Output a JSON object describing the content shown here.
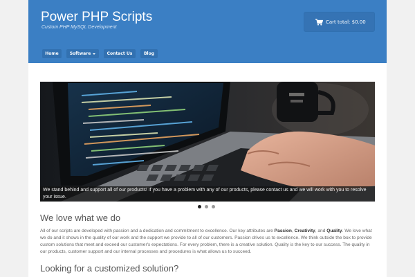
{
  "site": {
    "title": "Power PHP Scripts",
    "tagline": "Custom PHP MySQL Development"
  },
  "cart": {
    "label": "Cart total: $0.00",
    "icon": "shopping-cart-icon"
  },
  "nav": {
    "items": [
      {
        "label": "Home"
      },
      {
        "label": "Software",
        "has_dropdown": true
      },
      {
        "label": "Contact Us"
      },
      {
        "label": "Blog"
      }
    ]
  },
  "slider": {
    "caption": "We stand behind and support all of our products! If you have a problem with any of our products, please contact us and we will work with you to resolve your issue.",
    "image": "laptop-typing-code-photo",
    "dots": 3,
    "active_dot": 1
  },
  "intro": {
    "heading": "We love what we do",
    "text_before": "All of our scripts are developed with passion and a dedication and commitment to excellence. Our key attributes are ",
    "kw1": "Passion",
    "sep1": ", ",
    "kw2": "Creativity",
    "sep2": ", and ",
    "kw3": "Quality",
    "text_after": ". We love what we do and it shows in the quality of our work and the support we provide to all of our customers. Passion drives us to excellence. We think outside the box to provide custom solutions that meet and exceed our customer's expectations. For every problem, there is a creative solution. Quality is the key to our success. The quality in our products, customer support and our internal processes and procedures is what allows us to succeed."
  },
  "custom": {
    "heading": "Looking for a customized solution?"
  },
  "colors": {
    "header": "#3b7fc4",
    "nav_button": "#3271b1",
    "dot_active": "#222222",
    "dot_inactive": "#999999"
  }
}
